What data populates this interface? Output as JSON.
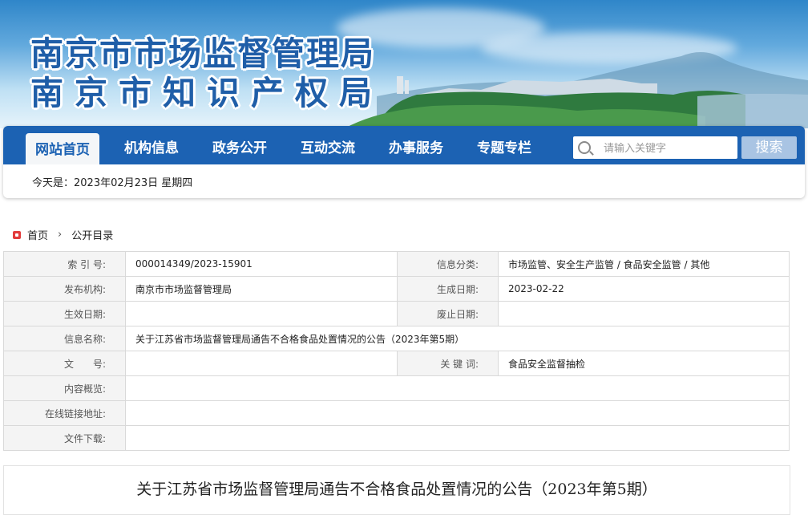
{
  "banner": {
    "line1": "南京市市场监督管理局",
    "line2": "南京市知识产权局"
  },
  "nav": {
    "items": [
      {
        "label": "网站首页",
        "active": true
      },
      {
        "label": "机构信息"
      },
      {
        "label": "政务公开"
      },
      {
        "label": "互动交流"
      },
      {
        "label": "办事服务"
      },
      {
        "label": "专题专栏"
      }
    ],
    "search_placeholder": "请输入关键字",
    "search_button": "搜索",
    "today": "今天是：2023年02月23日  星期四"
  },
  "breadcrumb": {
    "home": "首页",
    "current": "公开目录"
  },
  "info": {
    "index_label": "索 引 号:",
    "index_value": "000014349/2023-15901",
    "category_label": "信息分类:",
    "category_value": "市场监管、安全生产监管 / 食品安全监管 / 其他",
    "publisher_label": "发布机构:",
    "publisher_value": "南京市市场监督管理局",
    "created_label": "生成日期:",
    "created_value": "2023-02-22",
    "effective_label": "生效日期:",
    "effective_value": "",
    "abolish_label": "废止日期:",
    "abolish_value": "",
    "name_label": "信息名称:",
    "name_value": "关于江苏省市场监督管理局通告不合格食品处置情况的公告（2023年第5期）",
    "doc_label": "文　　号:",
    "doc_value": "",
    "keywords_label": "关 键 词:",
    "keywords_value": "食品安全监督抽检",
    "summary_label": "内容概览:",
    "summary_value": "",
    "link_label": "在线链接地址:",
    "link_value": "",
    "download_label": "文件下载:",
    "download_value": ""
  },
  "article": {
    "title": "关于江苏省市场监督管理局通告不合格食品处置情况的公告（2023年第5期）"
  },
  "colors": {
    "nav_blue": "#1c62b3",
    "title_blue": "#1f5ea8",
    "search_button": "#a9c4e3",
    "home_icon": "#e23c3c"
  }
}
